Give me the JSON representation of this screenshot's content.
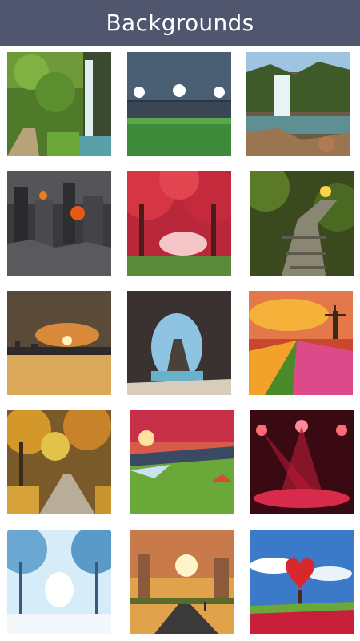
{
  "header": {
    "title": "Backgrounds",
    "bg_color": "#4f566e"
  },
  "backgrounds": [
    {
      "name": "forest-waterfall"
    },
    {
      "name": "football-stadium"
    },
    {
      "name": "rocky-waterfall"
    },
    {
      "name": "burning-ruined-city"
    },
    {
      "name": "red-autumn-forest-path"
    },
    {
      "name": "forest-stone-stairs"
    },
    {
      "name": "city-sunset"
    },
    {
      "name": "sea-cave-arch"
    },
    {
      "name": "tulip-field-windmill"
    },
    {
      "name": "autumn-park-road"
    },
    {
      "name": "sunset-valley-hills"
    },
    {
      "name": "red-spotlight-stage"
    },
    {
      "name": "snowy-tree-alley"
    },
    {
      "name": "ruined-city-road-sunset"
    },
    {
      "name": "heart-tree-field"
    }
  ]
}
